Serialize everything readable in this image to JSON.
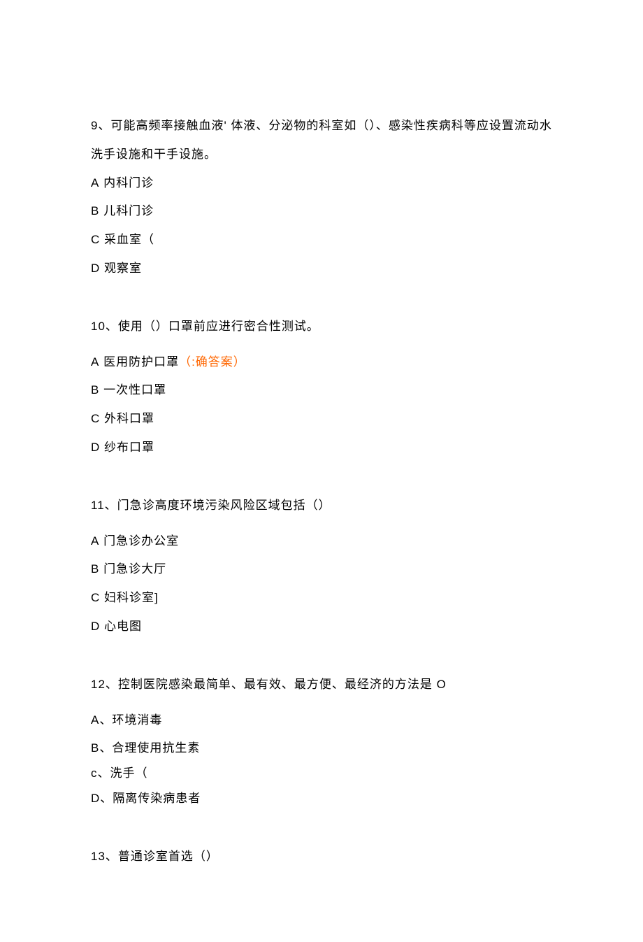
{
  "questions": [
    {
      "number": "9、",
      "text": "可能高频率接触血液' 体液、分泌物的科室如（）、感染性疾病科等应设置流动水洗手设施和干手设施。",
      "options": [
        {
          "letter": "A",
          "text": " 内科门诊",
          "mark": ""
        },
        {
          "letter": "B",
          "text": " 儿科门诊",
          "mark": ""
        },
        {
          "letter": "C",
          "text": " 采血室（",
          "mark": ""
        },
        {
          "letter": "D",
          "text": " 观察室",
          "mark": ""
        }
      ]
    },
    {
      "number": "10、",
      "text": "使用（）口罩前应进行密合性测试。",
      "options": [
        {
          "letter": "A",
          "text": " 医用防护口罩",
          "mark": "（:确答案）"
        },
        {
          "letter": "B",
          "text": " 一次性口罩",
          "mark": ""
        },
        {
          "letter": "C",
          "text": " 外科口罩",
          "mark": ""
        },
        {
          "letter": "D",
          "text": " 纱布口罩",
          "mark": ""
        }
      ]
    },
    {
      "number": "11、",
      "text": "门急诊高度环境污染风险区域包括（）",
      "options": [
        {
          "letter": "A",
          "text": " 门急诊办公室",
          "mark": ""
        },
        {
          "letter": "B",
          "text": " 门急诊大厅",
          "mark": ""
        },
        {
          "letter": "C",
          "text": " 妇科诊室]",
          "mark": ""
        },
        {
          "letter": "D",
          "text": " 心电图",
          "mark": ""
        }
      ]
    },
    {
      "number": "12、",
      "text": "控制医院感染最简单、最有效、最方便、最经济的方法是 O",
      "options": [
        {
          "letter": "A、",
          "text": "环境消毒",
          "mark": ""
        },
        {
          "letter": "B、",
          "text": "合理使用抗生素",
          "mark": ""
        },
        {
          "letter": "c、",
          "text": "洗手（",
          "mark": ""
        },
        {
          "letter": "D、",
          "text": "隔离传染病患者",
          "mark": ""
        }
      ]
    },
    {
      "number": "13、",
      "text": "普通诊室首选（）",
      "options": []
    }
  ]
}
